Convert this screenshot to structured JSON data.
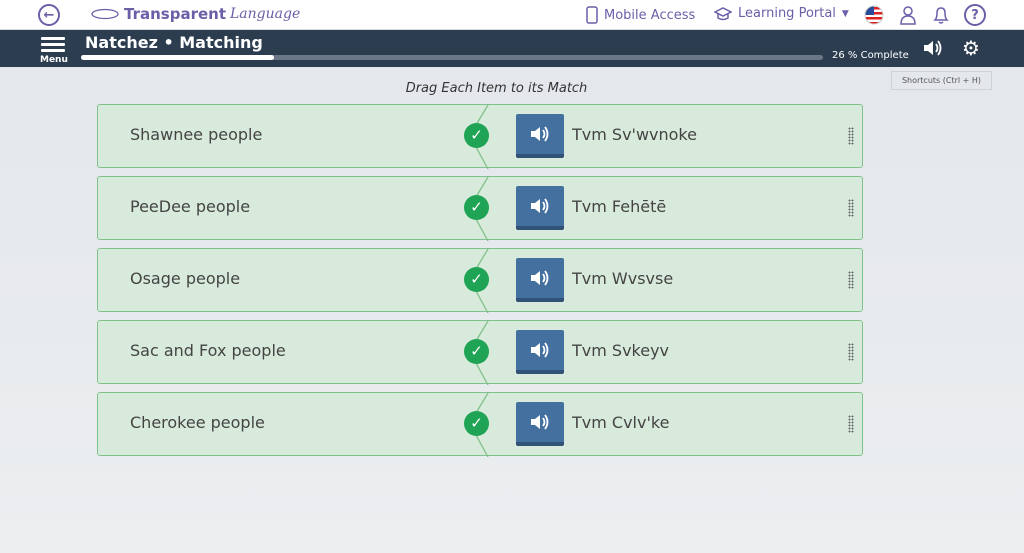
{
  "header": {
    "logo_bold": "Transparent",
    "logo_italic": "Language",
    "mobile_access": "Mobile Access",
    "learning_portal": "Learning Portal"
  },
  "lesson": {
    "menu_label": "Menu",
    "title": "Natchez • Matching",
    "progress_percent": 26,
    "progress_label": "26 % Complete",
    "shortcuts": "Shortcuts (Ctrl + H)"
  },
  "instructions": "Drag Each Item to its Match",
  "pairs": [
    {
      "left": "Shawnee people",
      "right": "Tvm Sv'wvnoke",
      "matched": true
    },
    {
      "left": "PeeDee people",
      "right": "Tvm Fehētē",
      "matched": true
    },
    {
      "left": "Osage people",
      "right": "Tvm Wvsvse",
      "matched": true
    },
    {
      "left": "Sac and Fox people",
      "right": "Tvm Svkeyv",
      "matched": true
    },
    {
      "left": "Cherokee people",
      "right": "Tvm Cvlv'ke",
      "matched": true
    }
  ],
  "colors": {
    "purple": "#6b5fa8",
    "bar": "#2c3d50",
    "match_bg": "#d8eadb",
    "check": "#1fa354",
    "audio": "#44709f"
  }
}
